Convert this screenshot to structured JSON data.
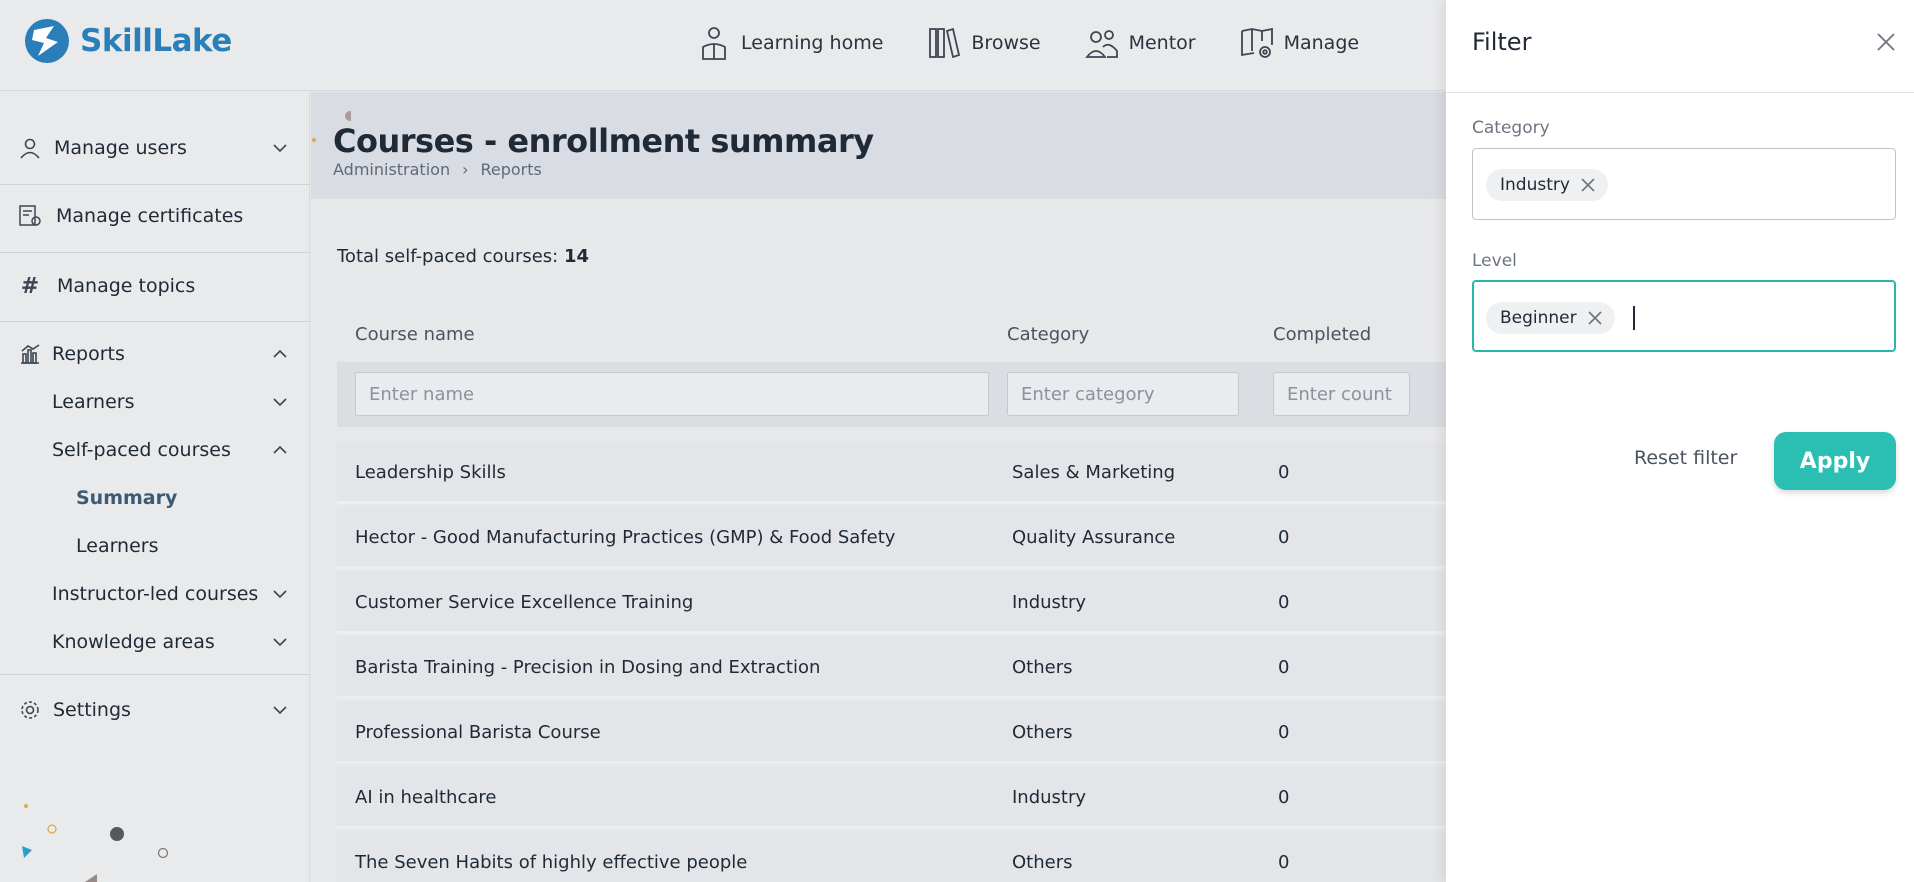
{
  "brand": {
    "name_part1": "Skill",
    "name_part2": "Lake"
  },
  "nav": [
    {
      "label": "Learning home",
      "icon": "learning-home-icon"
    },
    {
      "label": "Browse",
      "icon": "books-icon"
    },
    {
      "label": "Mentor",
      "icon": "mentor-icon"
    },
    {
      "label": "Manage",
      "icon": "manage-icon"
    }
  ],
  "sidebar": {
    "manage_users": "Manage users",
    "manage_certificates": "Manage certificates",
    "manage_topics": "Manage topics",
    "reports": "Reports",
    "learners": "Learners",
    "self_paced": "Self-paced courses",
    "summary": "Summary",
    "sub_learners": "Learners",
    "instructor_led": "Instructor-led courses",
    "knowledge_areas": "Knowledge areas",
    "settings": "Settings"
  },
  "page": {
    "title": "Courses - enrollment summary",
    "breadcrumb": [
      "Administration",
      "Reports"
    ],
    "total_label": "Total self-paced courses:",
    "total_value": "14"
  },
  "table": {
    "headers": [
      "Course name",
      "Category",
      "Completed"
    ],
    "filters": {
      "name_placeholder": "Enter name",
      "category_placeholder": "Enter category",
      "count_placeholder": "Enter count"
    },
    "rows": [
      {
        "name": "Leadership Skills",
        "category": "Sales & Marketing",
        "completed": "0"
      },
      {
        "name": "Hector - Good Manufacturing Practices (GMP) & Food Safety",
        "category": "Quality Assurance",
        "completed": "0"
      },
      {
        "name": "Customer Service Excellence Training",
        "category": "Industry",
        "completed": "0"
      },
      {
        "name": "Barista Training - Precision in Dosing and Extraction",
        "category": "Others",
        "completed": "0"
      },
      {
        "name": "Professional Barista Course",
        "category": "Others",
        "completed": "0"
      },
      {
        "name": "AI in healthcare",
        "category": "Industry",
        "completed": "0"
      },
      {
        "name": "The Seven Habits of highly effective people",
        "category": "Others",
        "completed": "0"
      }
    ]
  },
  "filter_panel": {
    "title": "Filter",
    "category_label": "Category",
    "category_chip": "Industry",
    "level_label": "Level",
    "level_chip": "Beginner",
    "reset_label": "Reset filter",
    "apply_label": "Apply"
  },
  "colors": {
    "accent": "#2bbfb3",
    "brand": "#2a7fb8"
  }
}
